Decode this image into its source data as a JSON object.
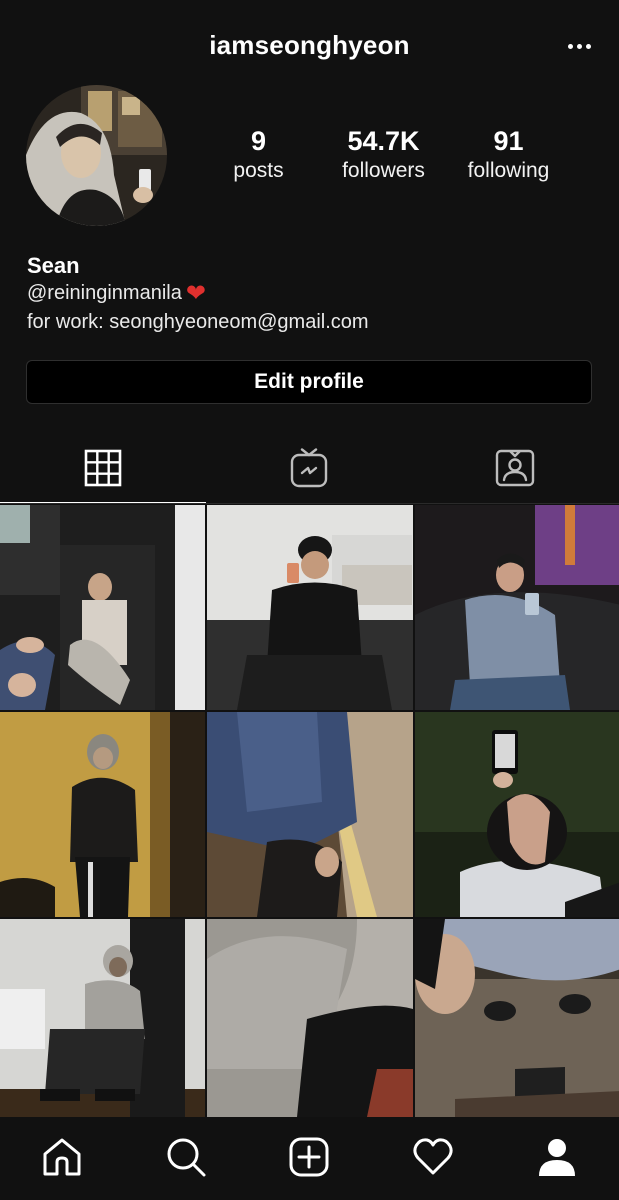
{
  "header": {
    "username": "iamseonghyeon",
    "more_icon": "more-horizontal-icon"
  },
  "profile": {
    "posts_count": "9",
    "posts_label": "posts",
    "followers_count": "54.7K",
    "followers_label": "followers",
    "following_count": "91",
    "following_label": "following"
  },
  "bio": {
    "name": "Sean",
    "handle": "@reininginmanila",
    "heart": "❤",
    "work": "for work: seonghyeoneom@gmail.com"
  },
  "actions": {
    "edit_profile": "Edit profile"
  },
  "tabs": [
    {
      "icon": "grid-icon",
      "active": true
    },
    {
      "icon": "igtv-icon",
      "active": false
    },
    {
      "icon": "tagged-icon",
      "active": false
    }
  ],
  "posts": [
    {
      "id": "post-1"
    },
    {
      "id": "post-2"
    },
    {
      "id": "post-3"
    },
    {
      "id": "post-4"
    },
    {
      "id": "post-5"
    },
    {
      "id": "post-6"
    },
    {
      "id": "post-7"
    },
    {
      "id": "post-8"
    },
    {
      "id": "post-9"
    }
  ],
  "nav": [
    {
      "icon": "home-icon"
    },
    {
      "icon": "search-icon"
    },
    {
      "icon": "add-post-icon"
    },
    {
      "icon": "heart-icon"
    },
    {
      "icon": "profile-icon",
      "active": true
    }
  ],
  "colors": {
    "background": "#111111",
    "text": "#ffffff",
    "heart": "#e0302e"
  }
}
